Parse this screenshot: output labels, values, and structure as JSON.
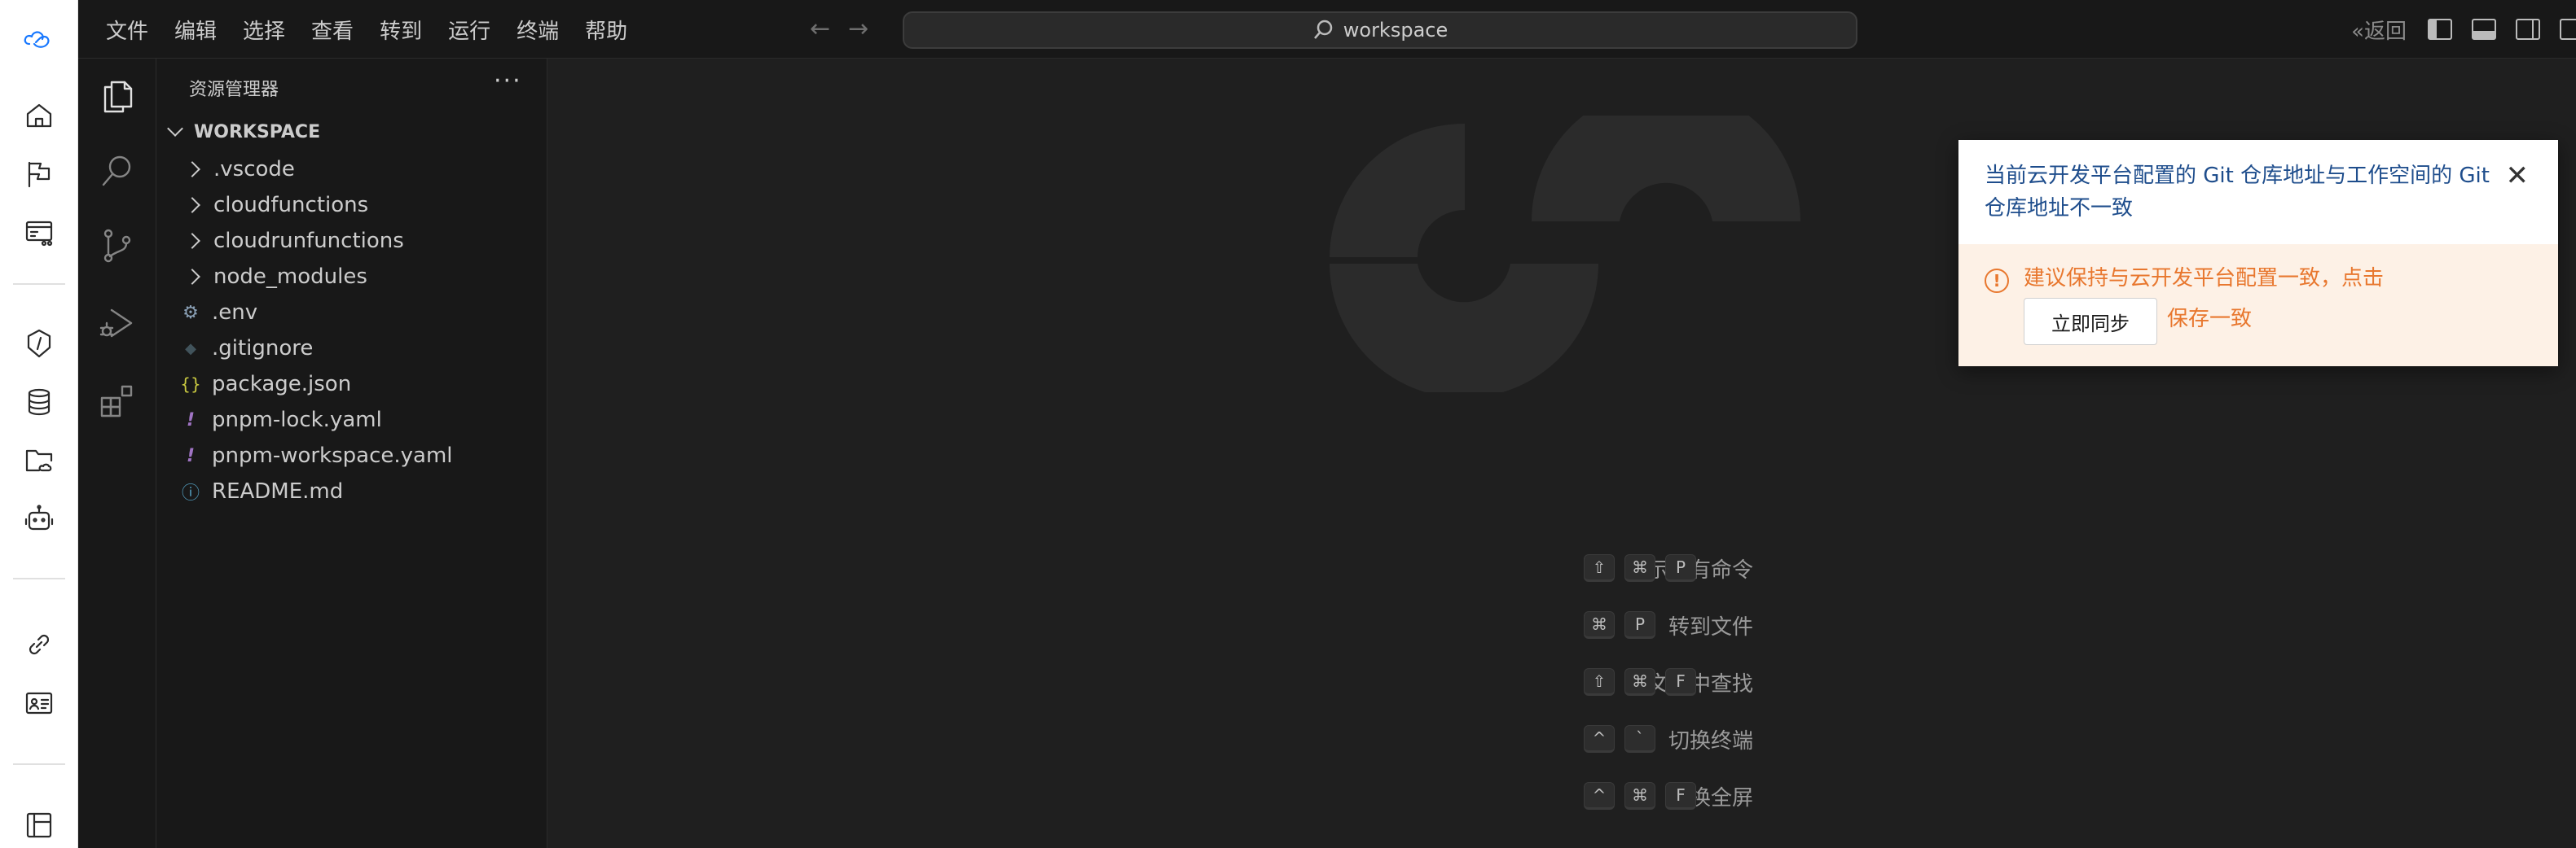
{
  "titlebar": {
    "menu": [
      "文件",
      "编辑",
      "选择",
      "查看",
      "转到",
      "运行",
      "终端",
      "帮助"
    ],
    "search_text": "workspace",
    "back_label": "返回"
  },
  "sidebar": {
    "title": "资源管理器",
    "more": "···",
    "workspace_label": "WORKSPACE",
    "folders": [
      ".vscode",
      "cloudfunctions",
      "cloudrunfunctions",
      "node_modules"
    ],
    "files": [
      ".env",
      ".gitignore",
      "package.json",
      "pnpm-lock.yaml",
      "pnpm-workspace.yaml",
      "README.md"
    ],
    "file_icons": [
      "⚙",
      "◆",
      "{}",
      "!",
      "!",
      "ⓘ"
    ]
  },
  "shortcuts": [
    {
      "label": "显示所有命令",
      "keys": [
        "⇧",
        "⌘",
        "P"
      ]
    },
    {
      "label": "转到文件",
      "keys": [
        "⌘",
        "P"
      ]
    },
    {
      "label": "在文件中查找",
      "keys": [
        "⇧",
        "⌘",
        "F"
      ]
    },
    {
      "label": "切换终端",
      "keys": [
        "^",
        "`"
      ]
    },
    {
      "label": "切换全屏",
      "keys": [
        "^",
        "⌘",
        "F"
      ]
    }
  ],
  "notification": {
    "message": "当前云开发平台配置的 Git 仓库地址与工作空间的 Git 仓库地址不一致",
    "warning_text": "建议保持与云开发平台配置一致，点击",
    "button_label": "立即同步",
    "warning_tail": "保存一致",
    "close": "✕"
  },
  "colors": {
    "accent_warning": "#e8772e",
    "notification_title": "#1e4d8c",
    "editor_bg": "#1f1f1f",
    "sidebar_bg": "#181818"
  }
}
